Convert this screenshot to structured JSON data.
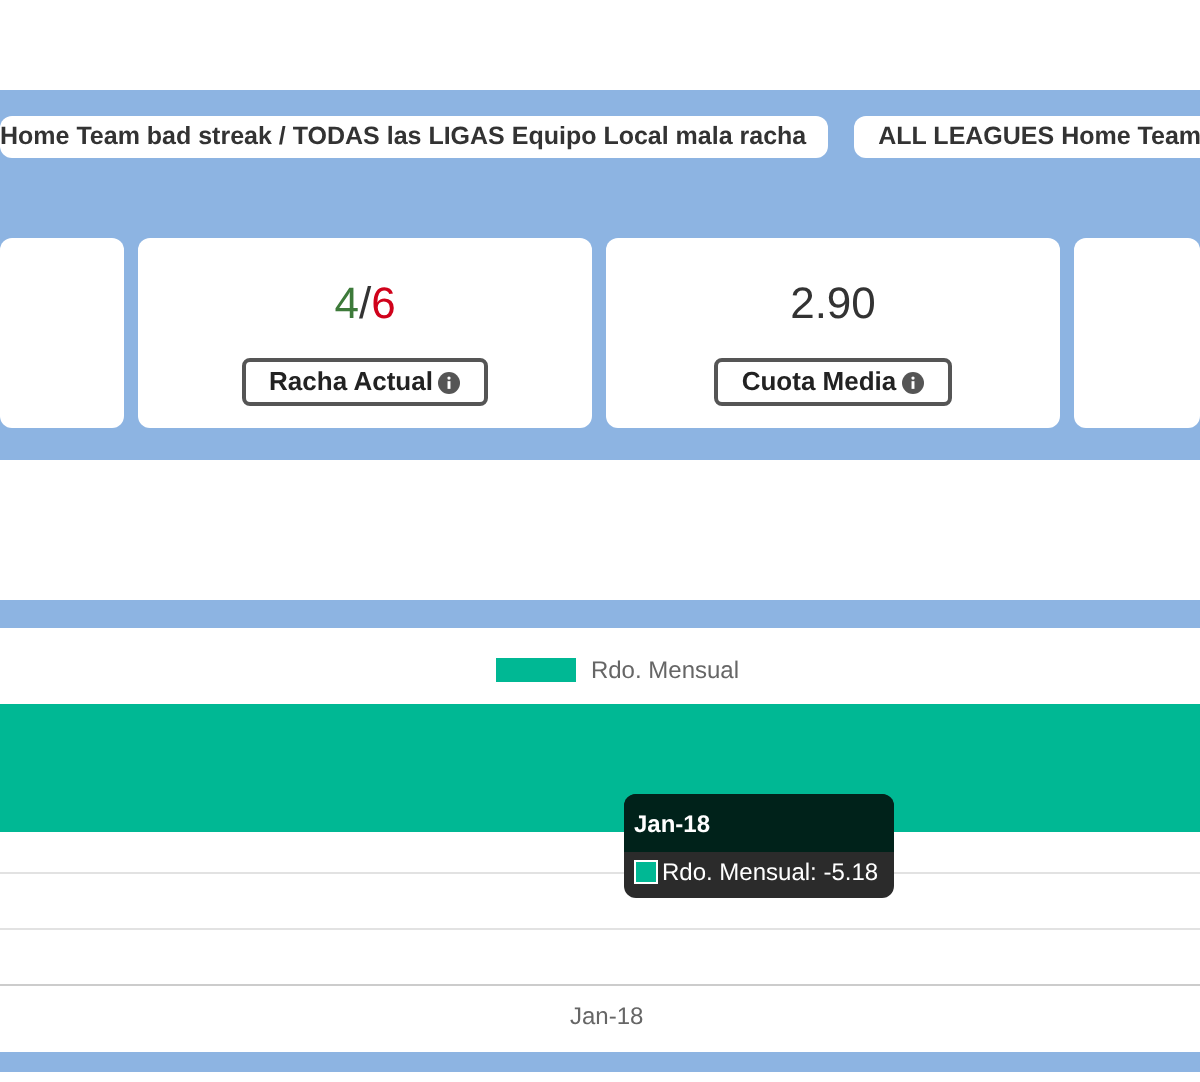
{
  "tabs": [
    {
      "label": "Home Team bad streak / TODAS las LIGAS Equipo Local mala racha"
    },
    {
      "label": "ALL LEAGUES Home Team"
    }
  ],
  "cards": [
    {
      "kind": "empty"
    },
    {
      "kind": "streak",
      "wins": "4",
      "separator": "/",
      "total": "6",
      "label": "Racha Actual"
    },
    {
      "kind": "value",
      "value": "2.90",
      "label": "Cuota Media"
    },
    {
      "kind": "empty"
    }
  ],
  "chart": {
    "legend": "Rdo. Mensual",
    "x_label": "Jan-18",
    "tooltip": {
      "title": "Jan-18",
      "text": "Rdo. Mensual: -5.18"
    }
  }
}
